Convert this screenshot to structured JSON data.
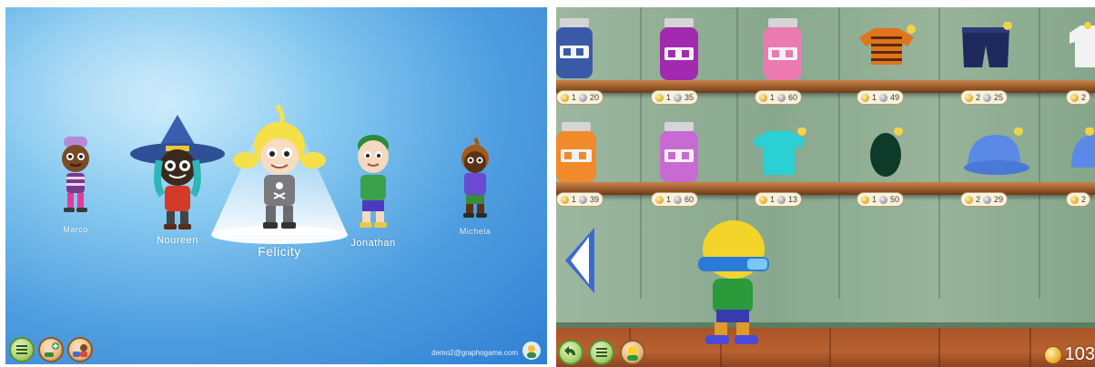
{
  "character_select": {
    "characters": [
      {
        "name": "Marco"
      },
      {
        "name": "Noureen"
      },
      {
        "name": "Felicity",
        "selected": true
      },
      {
        "name": "Jonathan"
      },
      {
        "name": "Michela"
      }
    ],
    "account_email": "demo2@graphogame.com",
    "buttons": {
      "menu": "list-icon",
      "add_player": "add-player-icon",
      "players": "players-group-icon",
      "profile": "profile-icon"
    }
  },
  "shop": {
    "shelf_rows": [
      {
        "items": [
          {
            "item": "jar-blue",
            "gold": "1",
            "silver": "20"
          },
          {
            "item": "jar-purple",
            "gold": "1",
            "silver": "35"
          },
          {
            "item": "jar-pink",
            "gold": "1",
            "silver": "60"
          },
          {
            "item": "striped-sweater",
            "gold": "1",
            "silver": "49"
          },
          {
            "item": "navy-shorts",
            "gold": "2",
            "silver": "25"
          },
          {
            "item": "white-shirt",
            "gold": "2",
            "silver": ""
          }
        ]
      },
      {
        "items": [
          {
            "item": "jar-orange",
            "gold": "1",
            "silver": "39"
          },
          {
            "item": "jar-violet",
            "gold": "1",
            "silver": "60"
          },
          {
            "item": "cyan-shirt",
            "gold": "1",
            "silver": "13"
          },
          {
            "item": "green-beanie",
            "gold": "1",
            "silver": "50"
          },
          {
            "item": "blue-cap",
            "gold": "2",
            "silver": "29"
          },
          {
            "item": "blue-cap-2",
            "gold": "2",
            "silver": ""
          }
        ]
      }
    ],
    "coins_total": "103",
    "buttons": {
      "back": "back-arrow-icon",
      "menu": "list-icon",
      "avatar": "avatar-icon",
      "scroll_left": "left-arrow-icon"
    }
  },
  "colors": {
    "sky_blue": "#4f9ee0",
    "wall_green": "#88a88d",
    "shelf_brown": "#9a5a2a",
    "floor_brown": "#b9622f",
    "button_green": "#aed67a",
    "coin_gold": "#e4a92a"
  }
}
